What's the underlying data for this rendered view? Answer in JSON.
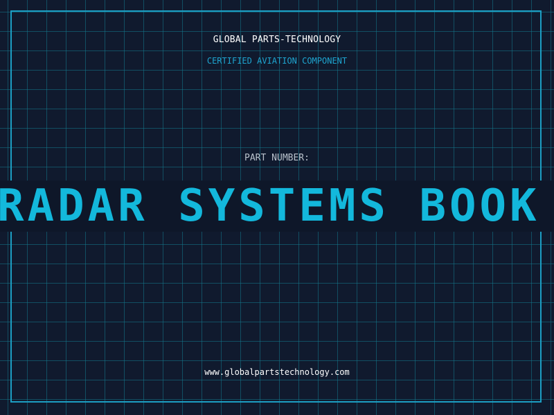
{
  "header": {
    "company_name": "GLOBAL PARTS-TECHNOLOGY",
    "tagline": "CERTIFIED AVIATION COMPONENT"
  },
  "part": {
    "label": "PART NUMBER:",
    "value": "RADAR SYSTEMS BOOK"
  },
  "footer": {
    "website": "www.globalpartstechnology.com"
  },
  "colors": {
    "background": "#101a2e",
    "grid": "#14788c",
    "accent": "#13b8dc",
    "frame": "#1c9fc4"
  }
}
